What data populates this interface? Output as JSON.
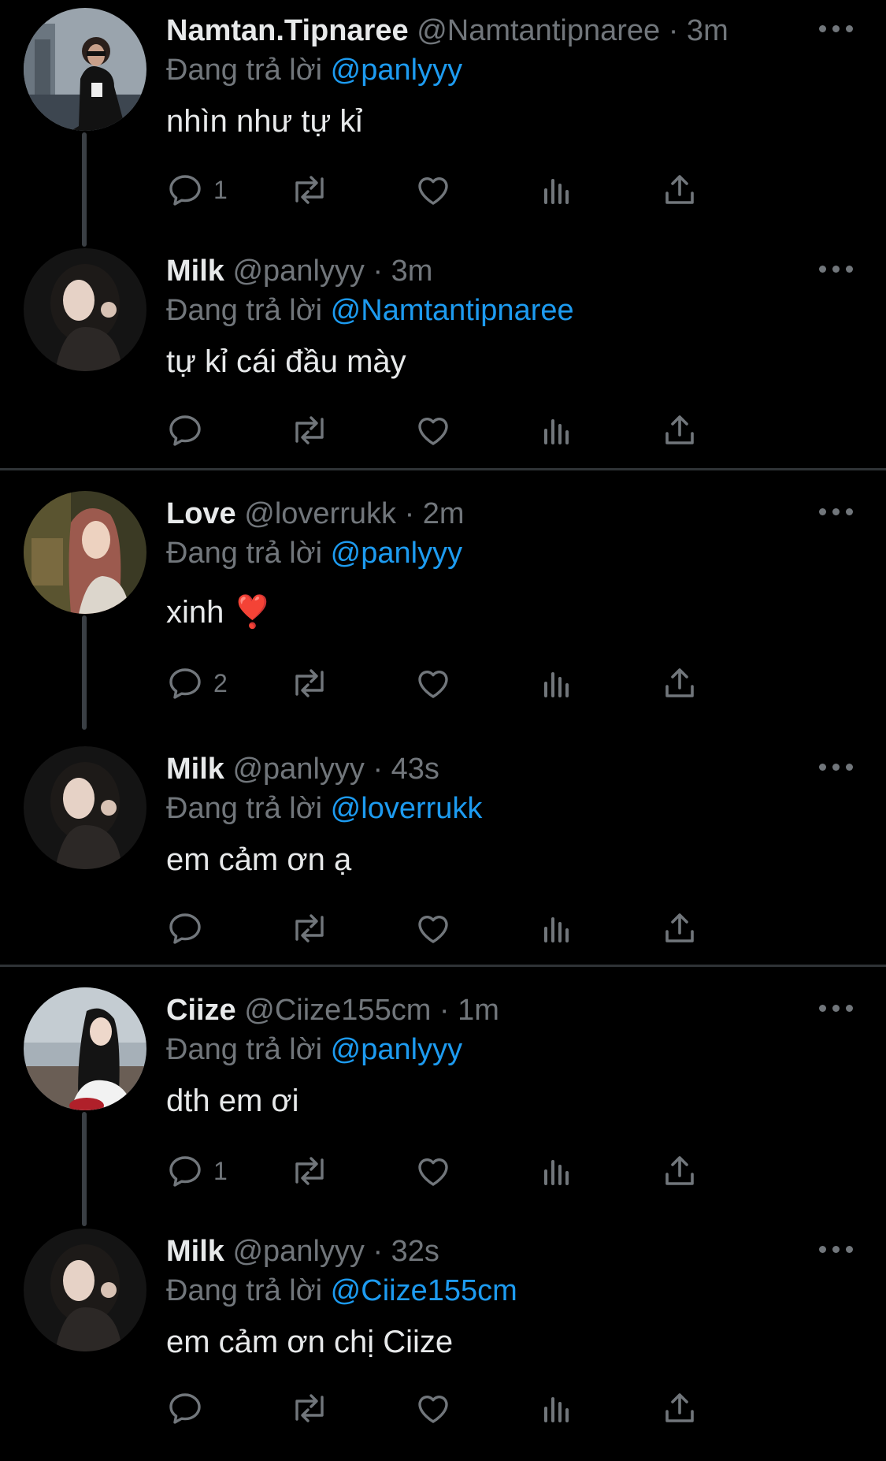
{
  "colors": {
    "background": "#000000",
    "text": "#e7e9ea",
    "secondary": "#71767b",
    "accent": "#1d9bf0",
    "divider": "#2f3336"
  },
  "replying_label": "Đang trả lời",
  "icons": [
    "reply-icon",
    "retweet-icon",
    "like-icon",
    "views-icon",
    "share-icon",
    "more-icon"
  ],
  "tweets": [
    {
      "name": "Namtan.Tipnaree",
      "handle": "@Namtantipnaree",
      "time": "· 3m",
      "mention": "@panlyyy",
      "text": "nhìn như tự kỉ",
      "reply_count": "1"
    },
    {
      "name": "Milk",
      "handle": "@panlyyy",
      "time": "· 3m",
      "mention": "@Namtantipnaree",
      "text": "tự kỉ cái đầu mày",
      "reply_count": ""
    },
    {
      "name": "Love",
      "handle": "@loverrukk",
      "time": "· 2m",
      "mention": "@panlyyy",
      "text": "xinh ❣️",
      "reply_count": "2"
    },
    {
      "name": "Milk",
      "handle": "@panlyyy",
      "time": "· 43s",
      "mention": "@loverrukk",
      "text": "em cảm ơn ạ",
      "reply_count": ""
    },
    {
      "name": "Ciize",
      "handle": "@Ciize155cm",
      "time": "· 1m",
      "mention": "@panlyyy",
      "text": "dth em ơi",
      "reply_count": "1"
    },
    {
      "name": "Milk",
      "handle": "@panlyyy",
      "time": "· 32s",
      "mention": "@Ciize155cm",
      "text": "em cảm ơn chị Ciize",
      "reply_count": ""
    }
  ]
}
